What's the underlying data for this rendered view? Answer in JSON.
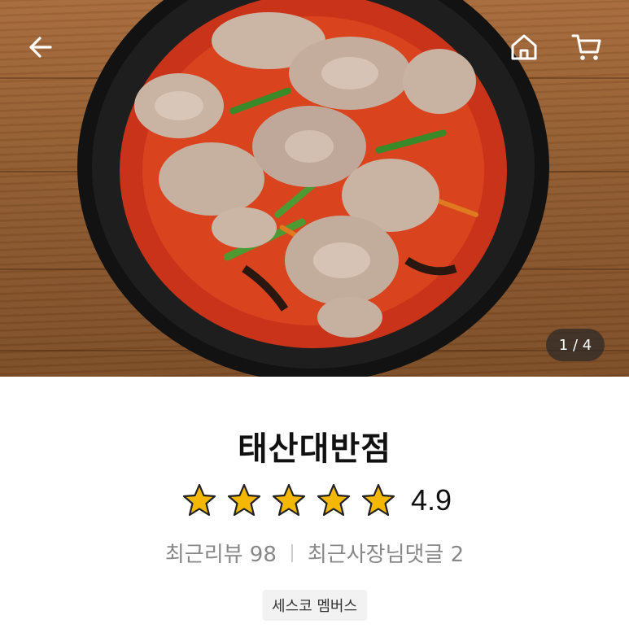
{
  "hero": {
    "image_alt": "food-photo",
    "counter": "1 / 4"
  },
  "nav": {
    "back_icon": "arrow-left-icon",
    "home_icon": "home-icon",
    "cart_icon": "cart-icon"
  },
  "store": {
    "name": "태산대반점",
    "rating": "4.9",
    "stars": 5,
    "recent_reviews": "최근리뷰 98",
    "owner_comments": "최근사장님댓글 2",
    "badge": "세스코 멤버스"
  },
  "colors": {
    "star": "#f5b800",
    "star_outline": "#222222",
    "text": "#111111",
    "meta": "#888888"
  }
}
